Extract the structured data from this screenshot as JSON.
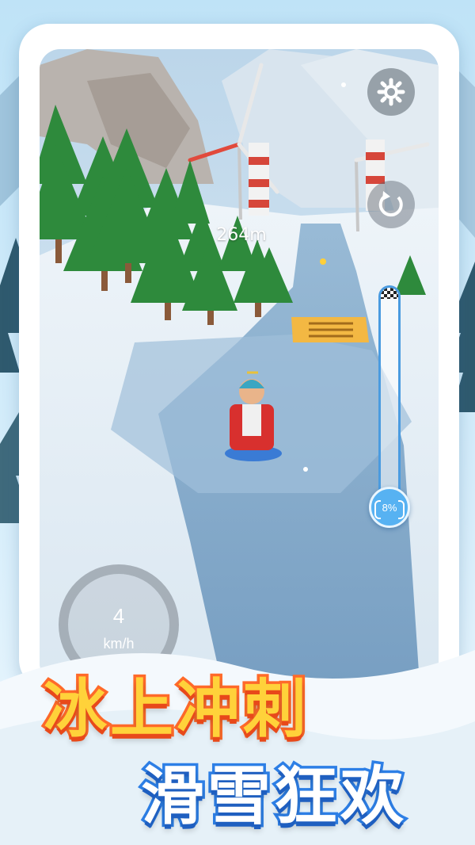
{
  "hud": {
    "distance": "264m",
    "speed_value": "4",
    "speed_unit": "km/h",
    "progress_label": "8%",
    "progress_fraction": 0.08
  },
  "buttons": {
    "settings_icon": "gear-icon",
    "restart_icon": "restart-icon"
  },
  "slogan": {
    "line1": "冰上冲刺",
    "line2": "滑雪狂欢"
  },
  "colors": {
    "slogan1_fill": "#ffd23a",
    "slogan1_stroke": "#ff6a2a",
    "slogan2_fill": "#ffffff",
    "slogan2_stroke": "#2d7fe6",
    "progress_accent": "#4a9be0"
  }
}
